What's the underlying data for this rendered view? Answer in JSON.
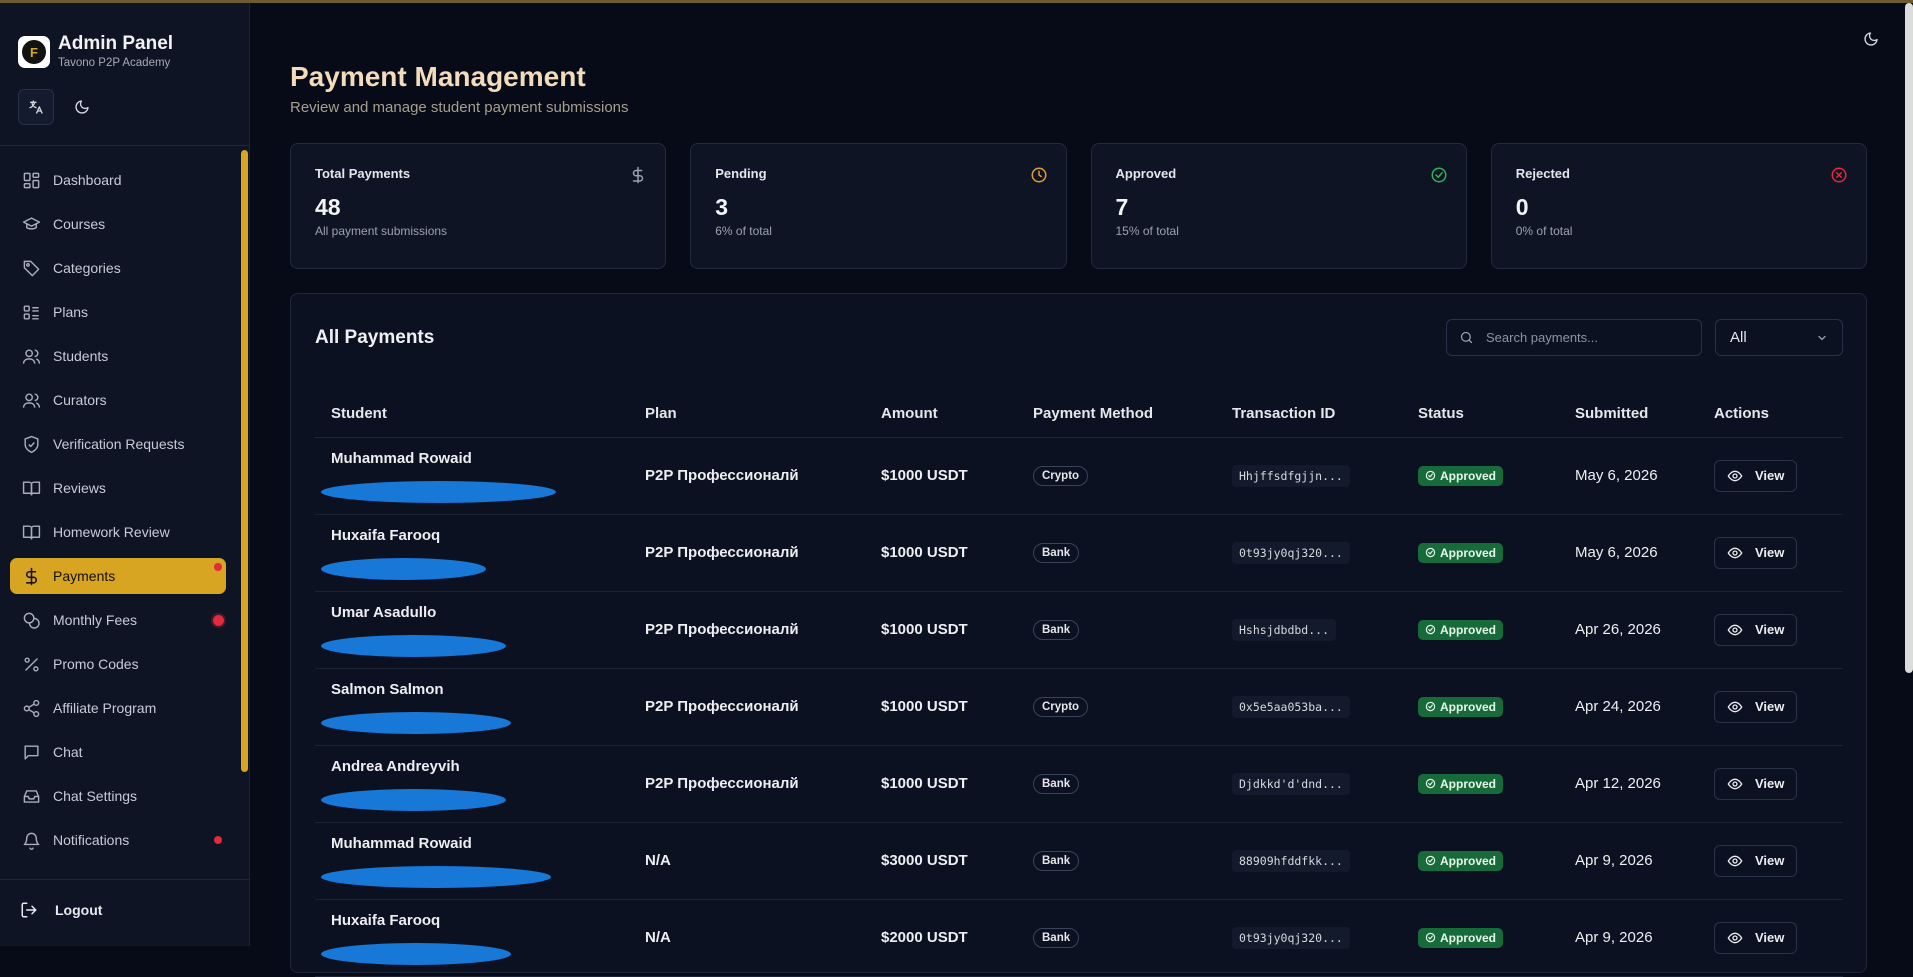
{
  "brand": {
    "title": "Admin Panel",
    "subtitle": "Tavono P2P Academy",
    "logo_letter": "F"
  },
  "sidebar": {
    "items": [
      {
        "label": "Dashboard",
        "icon": "dashboard-icon"
      },
      {
        "label": "Courses",
        "icon": "graduation-cap-icon"
      },
      {
        "label": "Categories",
        "icon": "tag-icon"
      },
      {
        "label": "Plans",
        "icon": "list-icon"
      },
      {
        "label": "Students",
        "icon": "users-icon"
      },
      {
        "label": "Curators",
        "icon": "users-icon"
      },
      {
        "label": "Verification Requests",
        "icon": "shield-icon"
      },
      {
        "label": "Reviews",
        "icon": "book-open-icon"
      },
      {
        "label": "Homework Review",
        "icon": "book-open-icon"
      },
      {
        "label": "Payments",
        "icon": "dollar-icon",
        "active": true,
        "badge": true
      },
      {
        "label": "Monthly Fees",
        "icon": "coins-icon",
        "badge": true
      },
      {
        "label": "Promo Codes",
        "icon": "percent-icon"
      },
      {
        "label": "Affiliate Program",
        "icon": "share-icon"
      },
      {
        "label": "Chat",
        "icon": "message-icon"
      },
      {
        "label": "Chat Settings",
        "icon": "inbox-icon"
      },
      {
        "label": "Notifications",
        "icon": "bell-icon",
        "badge": true
      }
    ],
    "logout_label": "Logout"
  },
  "page": {
    "title": "Payment Management",
    "subtitle": "Review and manage student payment submissions"
  },
  "stats": [
    {
      "label": "Total Payments",
      "value": "48",
      "note": "All payment submissions",
      "icon": "dollar-icon",
      "color": "#9aa0ad"
    },
    {
      "label": "Pending",
      "value": "3",
      "note": "6% of total",
      "icon": "clock-icon",
      "color": "#e0a030"
    },
    {
      "label": "Approved",
      "value": "7",
      "note": "15% of total",
      "icon": "check-circle-icon",
      "color": "#2fb35a"
    },
    {
      "label": "Rejected",
      "value": "0",
      "note": "0% of total",
      "icon": "x-circle-icon",
      "color": "#e5283a"
    }
  ],
  "payments": {
    "title": "All Payments",
    "search_placeholder": "Search payments...",
    "filter_value": "All",
    "columns": [
      "Student",
      "Plan",
      "Amount",
      "Payment Method",
      "Transaction ID",
      "Status",
      "Submitted",
      "Actions"
    ],
    "rows": [
      {
        "student": "Muhammad Rowaid",
        "plan": "P2P Профессионалй",
        "amount": "$1000 USDT",
        "method": "Crypto",
        "txid": "Hhjffsdfgjjn...",
        "status": "Approved",
        "submitted": "May 6, 2026",
        "action": "View"
      },
      {
        "student": "Huxaifa Farooq",
        "plan": "P2P Профессионалй",
        "amount": "$1000 USDT",
        "method": "Bank",
        "txid": "0t93jy0qj320...",
        "status": "Approved",
        "submitted": "May 6, 2026",
        "action": "View"
      },
      {
        "student": "Umar Asadullo",
        "plan": "P2P Профессионалй",
        "amount": "$1000 USDT",
        "method": "Bank",
        "txid": "Hshsjdbdbd...",
        "status": "Approved",
        "submitted": "Apr 26, 2026",
        "action": "View"
      },
      {
        "student": "Salmon Salmon",
        "plan": "P2P Профессионалй",
        "amount": "$1000 USDT",
        "method": "Crypto",
        "txid": "0x5e5aa053ba...",
        "status": "Approved",
        "submitted": "Apr 24, 2026",
        "action": "View"
      },
      {
        "student": "Andrea Andreyvih",
        "plan": "P2P Профессионалй",
        "amount": "$1000 USDT",
        "method": "Bank",
        "txid": "Djdkkd'd'dnd...",
        "status": "Approved",
        "submitted": "Apr 12, 2026",
        "action": "View"
      },
      {
        "student": "Muhammad Rowaid",
        "plan": "N/A",
        "amount": "$3000 USDT",
        "method": "Bank",
        "txid": "88909hfddfkk...",
        "status": "Approved",
        "submitted": "Apr 9, 2026",
        "action": "View"
      },
      {
        "student": "Huxaifa Farooq",
        "plan": "N/A",
        "amount": "$2000 USDT",
        "method": "Bank",
        "txid": "0t93jy0qj320...",
        "status": "Approved",
        "submitted": "Apr 9, 2026",
        "action": "View"
      }
    ]
  },
  "colors": {
    "accent": "#d7a521",
    "approved": "#176a3a",
    "background": "#070b17",
    "title": "#f3dcbd"
  }
}
